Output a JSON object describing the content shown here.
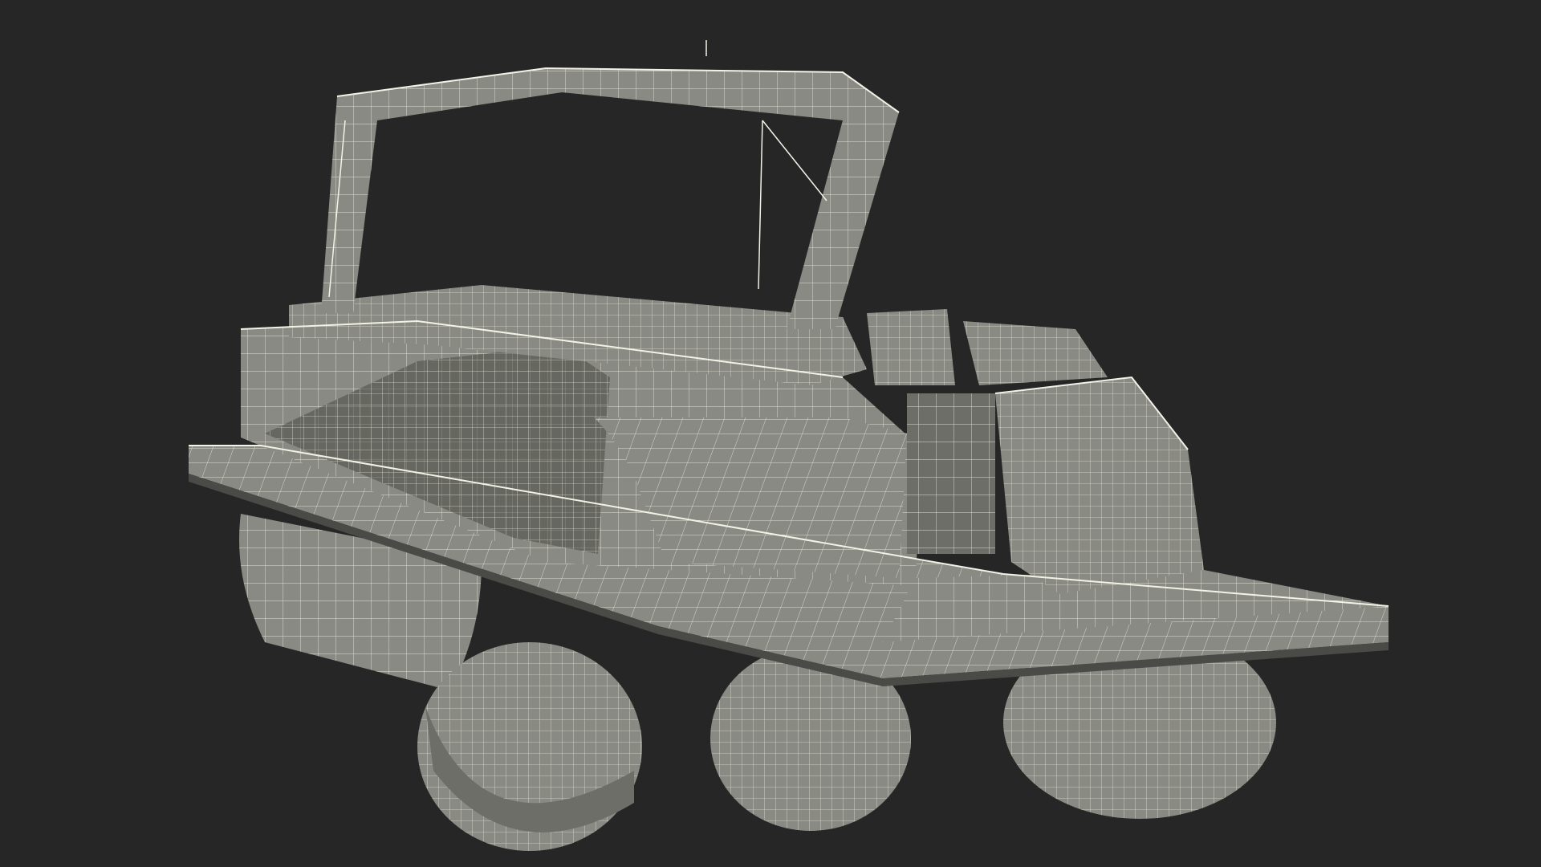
{
  "viewport": {
    "background_color": "#262626",
    "mesh_fill_color": "#8a8a84",
    "mesh_shade_color": "#6e6e69",
    "mesh_dark_color": "#4a4a47",
    "wire_color": "#f2f2e6",
    "subject": "pontoon-boat-wireframe-mesh"
  }
}
